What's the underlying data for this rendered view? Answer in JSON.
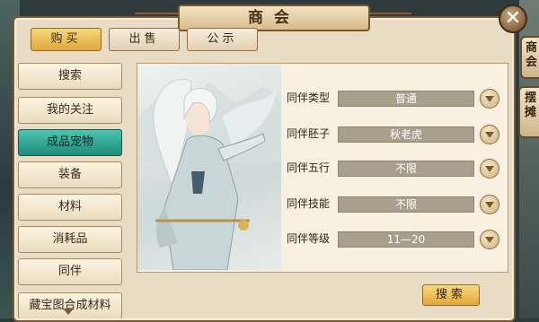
{
  "window": {
    "title": "商会"
  },
  "top_tabs": [
    {
      "label": "购买",
      "active": true
    },
    {
      "label": "出售",
      "active": false
    },
    {
      "label": "公示",
      "active": false
    }
  ],
  "side_tabs": [
    {
      "label": "商会"
    },
    {
      "label": "摆摊"
    }
  ],
  "categories": [
    {
      "label": "搜索",
      "active": false
    },
    {
      "label": "我的关注",
      "active": false
    },
    {
      "label": "成品宠物",
      "active": true
    },
    {
      "label": "装备",
      "active": false
    },
    {
      "label": "材料",
      "active": false
    },
    {
      "label": "消耗品",
      "active": false
    },
    {
      "label": "同伴",
      "active": false
    },
    {
      "label": "藏宝图合成材料",
      "active": false
    }
  ],
  "filters": [
    {
      "label": "同伴类型",
      "value": "普通"
    },
    {
      "label": "同伴胚子",
      "value": "秋老虎"
    },
    {
      "label": "同伴五行",
      "value": "不限"
    },
    {
      "label": "同伴技能",
      "value": "不限"
    },
    {
      "label": "同伴等级",
      "value": "11—20"
    }
  ],
  "search_button": {
    "label": "搜索"
  },
  "close_label": "✕",
  "colors": {
    "accent": "#e1a73a",
    "active_category": "#2a9d8a",
    "frame": "#7c5a37"
  }
}
